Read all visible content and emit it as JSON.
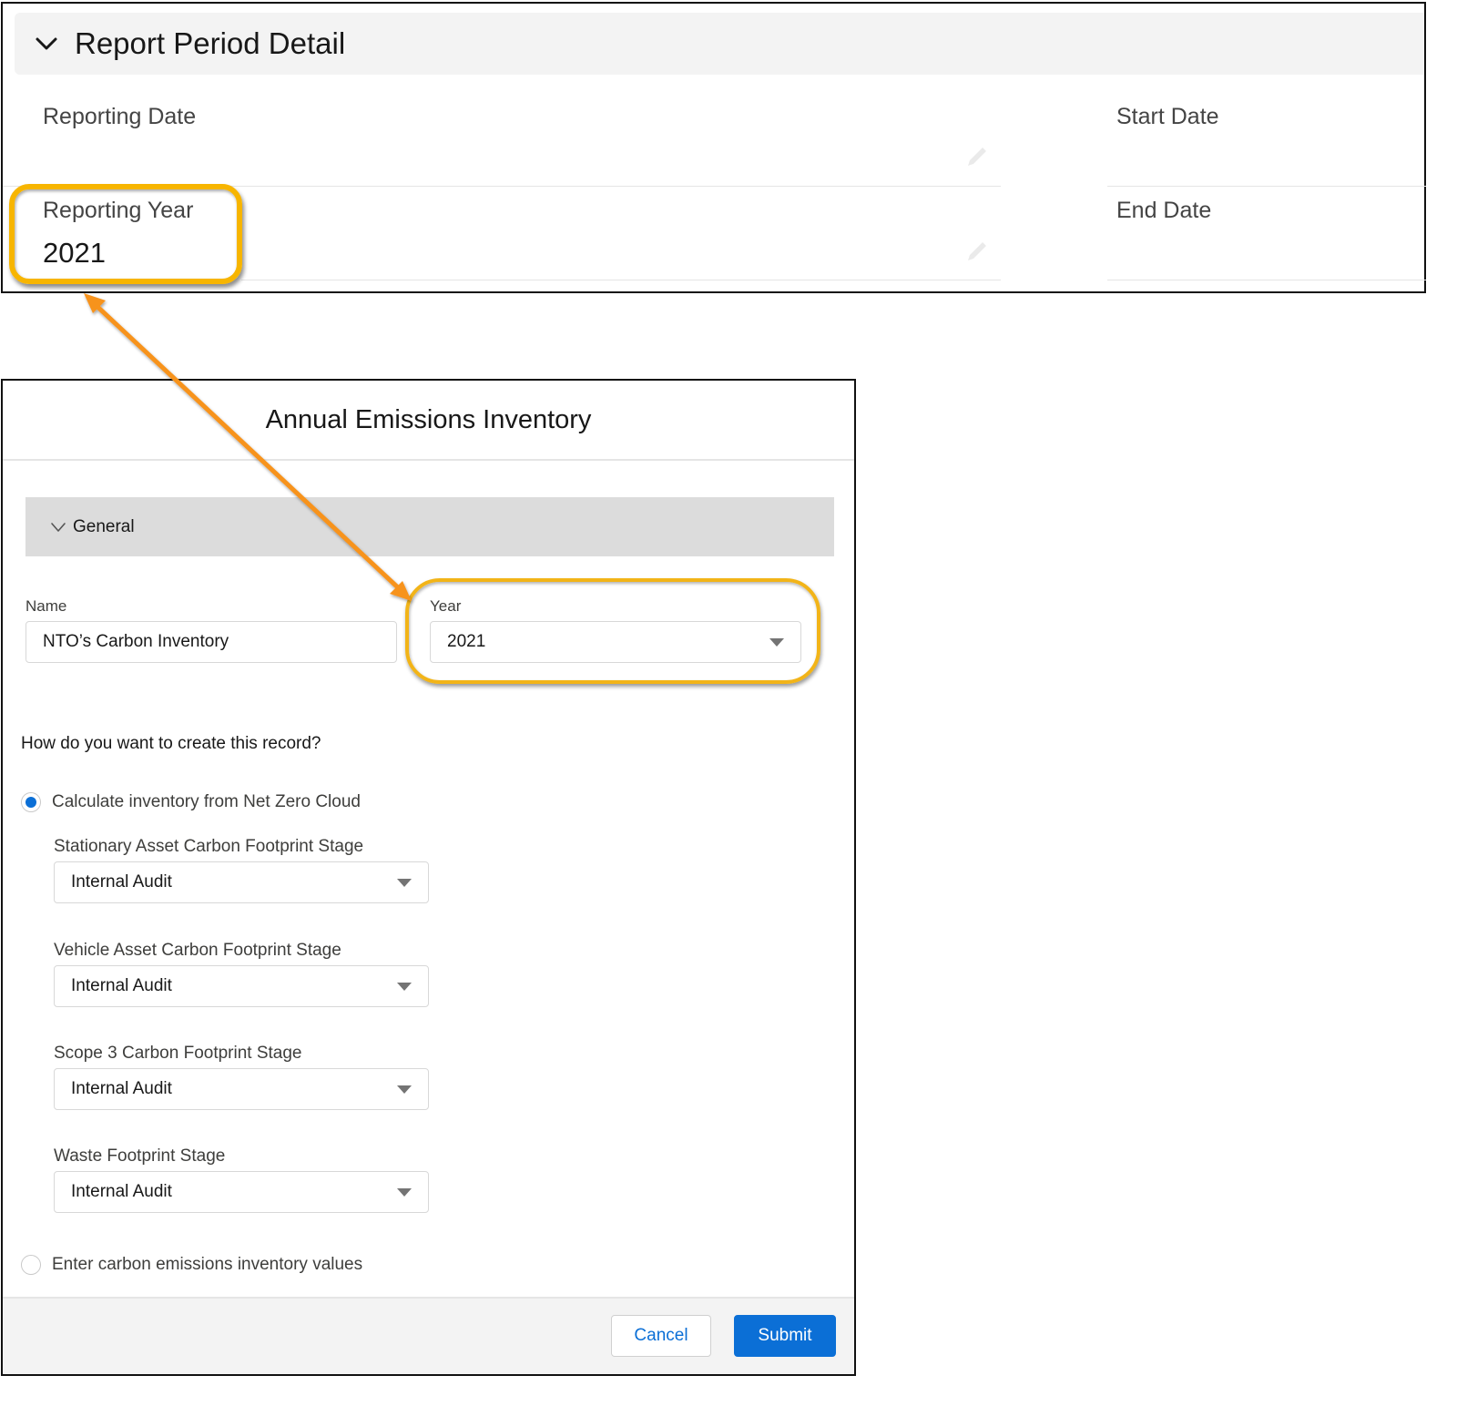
{
  "record_panel": {
    "section_title": "Report Period Detail",
    "fields": [
      {
        "label": "Reporting Date",
        "value": ""
      },
      {
        "label": "Start Date",
        "value": ""
      },
      {
        "label": "Reporting Year",
        "value": "2021"
      },
      {
        "label": "End Date",
        "value": ""
      }
    ]
  },
  "dialog": {
    "title": "Annual Emissions Inventory",
    "section_label": "General",
    "name_field": {
      "label": "Name",
      "value": "NTO’s Carbon Inventory"
    },
    "year_field": {
      "label": "Year",
      "value": "2021"
    },
    "question": "How do you want to create this record?",
    "options": [
      {
        "label": "Calculate inventory from Net Zero Cloud",
        "selected": true
      },
      {
        "label": "Enter carbon emissions inventory values",
        "selected": false
      }
    ],
    "stages": [
      {
        "label": "Stationary Asset Carbon Footprint Stage",
        "value": "Internal Audit"
      },
      {
        "label": "Vehicle Asset Carbon Footprint Stage",
        "value": "Internal Audit"
      },
      {
        "label": "Scope 3 Carbon Footprint Stage",
        "value": "Internal Audit"
      },
      {
        "label": "Waste Footprint Stage",
        "value": "Internal Audit"
      }
    ],
    "buttons": {
      "cancel": "Cancel",
      "submit": "Submit"
    }
  },
  "annotation": {
    "highlight_color": "#f7b500",
    "arrow_color": "#f7931e",
    "connects": [
      "Reporting Year",
      "Year"
    ]
  },
  "colors": {
    "brand_blue": "#0b6fd6",
    "header_gray": "#f3f3f3",
    "section_gray": "#dcdcdc"
  }
}
